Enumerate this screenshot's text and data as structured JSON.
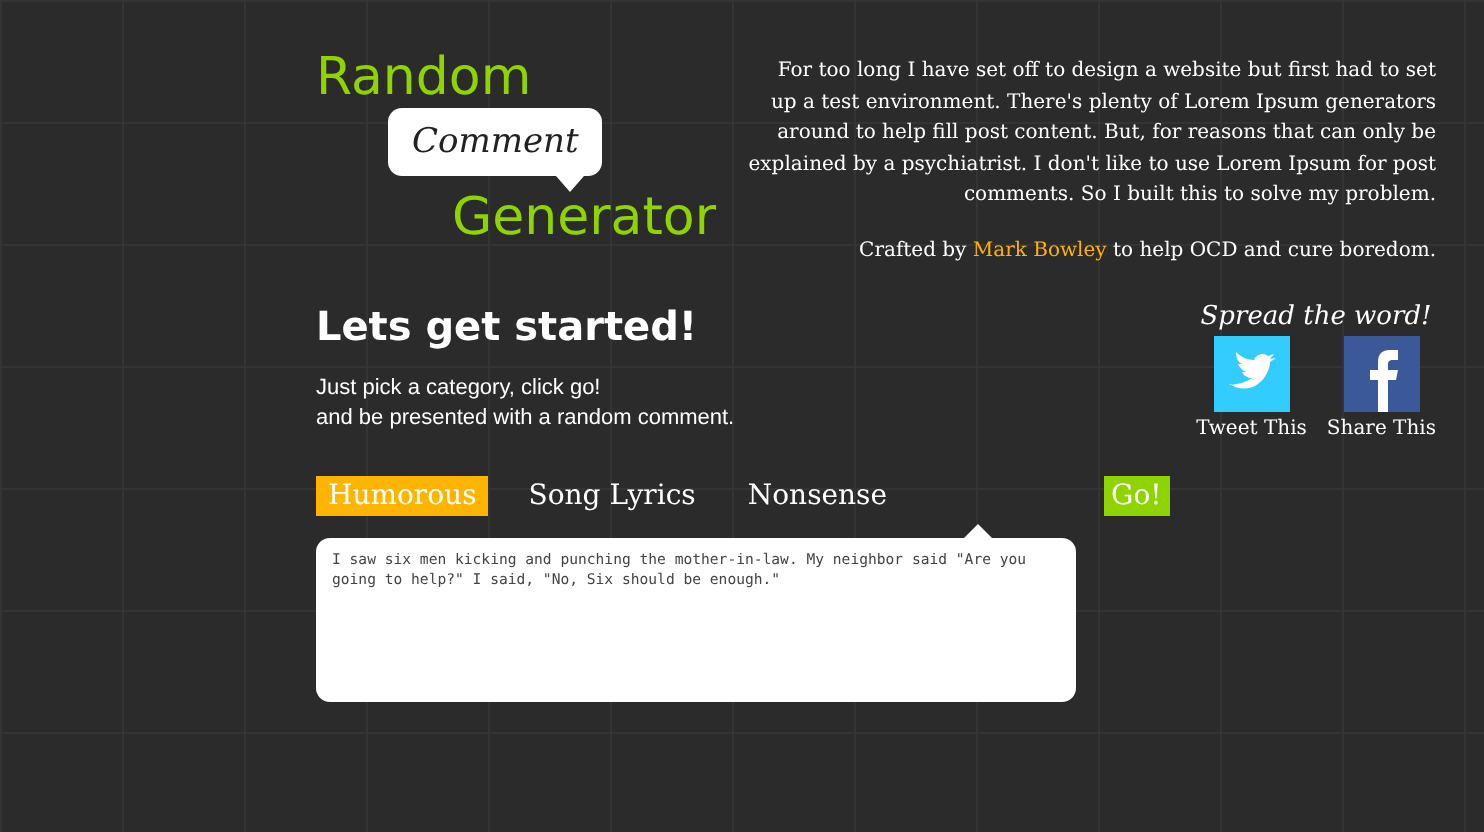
{
  "logo": {
    "line_1": "Random",
    "bubble": "Comment",
    "line_2": "Generator"
  },
  "about": {
    "text": "For too long I have set off to design a website but first had to set up a test environment. There's plenty of Lorem Ipsum generators around to help fill post content. But, for reasons that can only be explained by a psychiatrist. I don't like to use Lorem Ipsum for post comments. So I built this to solve my problem.",
    "credit_before": "Crafted by",
    "credit_link": "Mark Bowley",
    "credit_after": "to help OCD and cure boredom."
  },
  "intro": {
    "heading": "Lets get started!",
    "lines": [
      "Just pick a category, click go!",
      "and be presented with a random comment."
    ]
  },
  "share": {
    "heading": "Spread the word!",
    "buttons": [
      {
        "kind": "twitter",
        "label": "Tweet This"
      },
      {
        "kind": "facebook",
        "label": "Share This"
      }
    ]
  },
  "categories": [
    {
      "label": "Humorous",
      "selected": true
    },
    {
      "label": "Song Lyrics",
      "selected": false
    },
    {
      "label": "Nonsense",
      "selected": false
    }
  ],
  "go_button": "Go!",
  "comment": "I saw six men kicking and punching the mother-in-law. My neighbor said \"Are you going to help?\" I said, \"No, Six should be enough.\""
}
